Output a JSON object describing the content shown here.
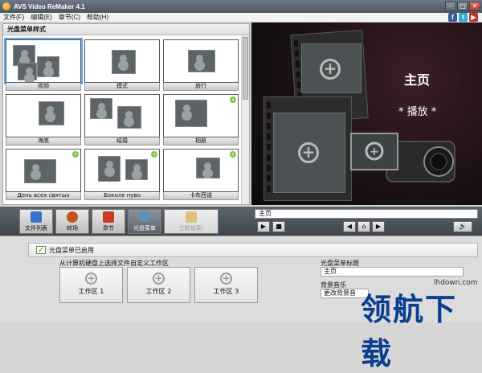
{
  "window": {
    "title": "AVS Video ReMaker 4.1",
    "min_glyph": "–",
    "max_glyph": "□",
    "close_glyph": "✕"
  },
  "menu": [
    "文件(F)",
    "编辑(E)",
    "章节(C)",
    "帮助(H)"
  ],
  "social": {
    "facebook": "f",
    "twitter": "t",
    "youtube": "▶"
  },
  "styles_panel": {
    "title": "光盘菜单样式",
    "thumbs": [
      {
        "label": "视频",
        "bg": "#2e3a44"
      },
      {
        "label": "模式",
        "bg": "#595e62"
      },
      {
        "label": "旅行",
        "bg": "#6aa4d8"
      },
      {
        "label": "海底",
        "bg": "#5f4d38"
      },
      {
        "label": "结婚",
        "bg": "#cfd6dc"
      },
      {
        "label": "相册",
        "bg": "#3e6d3e"
      },
      {
        "label": "День всех святых",
        "bg": "#4a2a14"
      },
      {
        "label": "Боколе нуво",
        "bg": "#8aa84a"
      },
      {
        "label": "卡布西诺",
        "bg": "#5a3a26"
      }
    ]
  },
  "preview": {
    "home": "主页",
    "play": "* 播放 *"
  },
  "toolbar": [
    {
      "label": "文件列表",
      "color": "#3a72c8"
    },
    {
      "label": "转场",
      "color": "#c6501e"
    },
    {
      "label": "章节",
      "color": "#c83a2a"
    },
    {
      "label": "光盘菜单",
      "color": "#5e8fb8"
    }
  ],
  "burn_button": "立即刻录!",
  "player": {
    "breadcrumb": "主页",
    "play_glyph": "▶",
    "stop_glyph": "■",
    "prev_glyph": "◀",
    "home_glyph": "⌂",
    "next_glyph": "▶",
    "volume_glyph": "🔊"
  },
  "menu_settings": {
    "enabled_label": "光盘菜单已启用",
    "workspace_title": "从计算机硬盘上选择文件自定义工作区",
    "workspaces": [
      "工作区 1",
      "工作区 2",
      "工作区 3"
    ],
    "title_label": "光盘菜单标题",
    "title_value": "主页",
    "bg_music_label": "背景音乐",
    "bg_music_value": "更改背景音"
  },
  "watermark": {
    "text": "领航下载",
    "url": "lhdown.com"
  }
}
